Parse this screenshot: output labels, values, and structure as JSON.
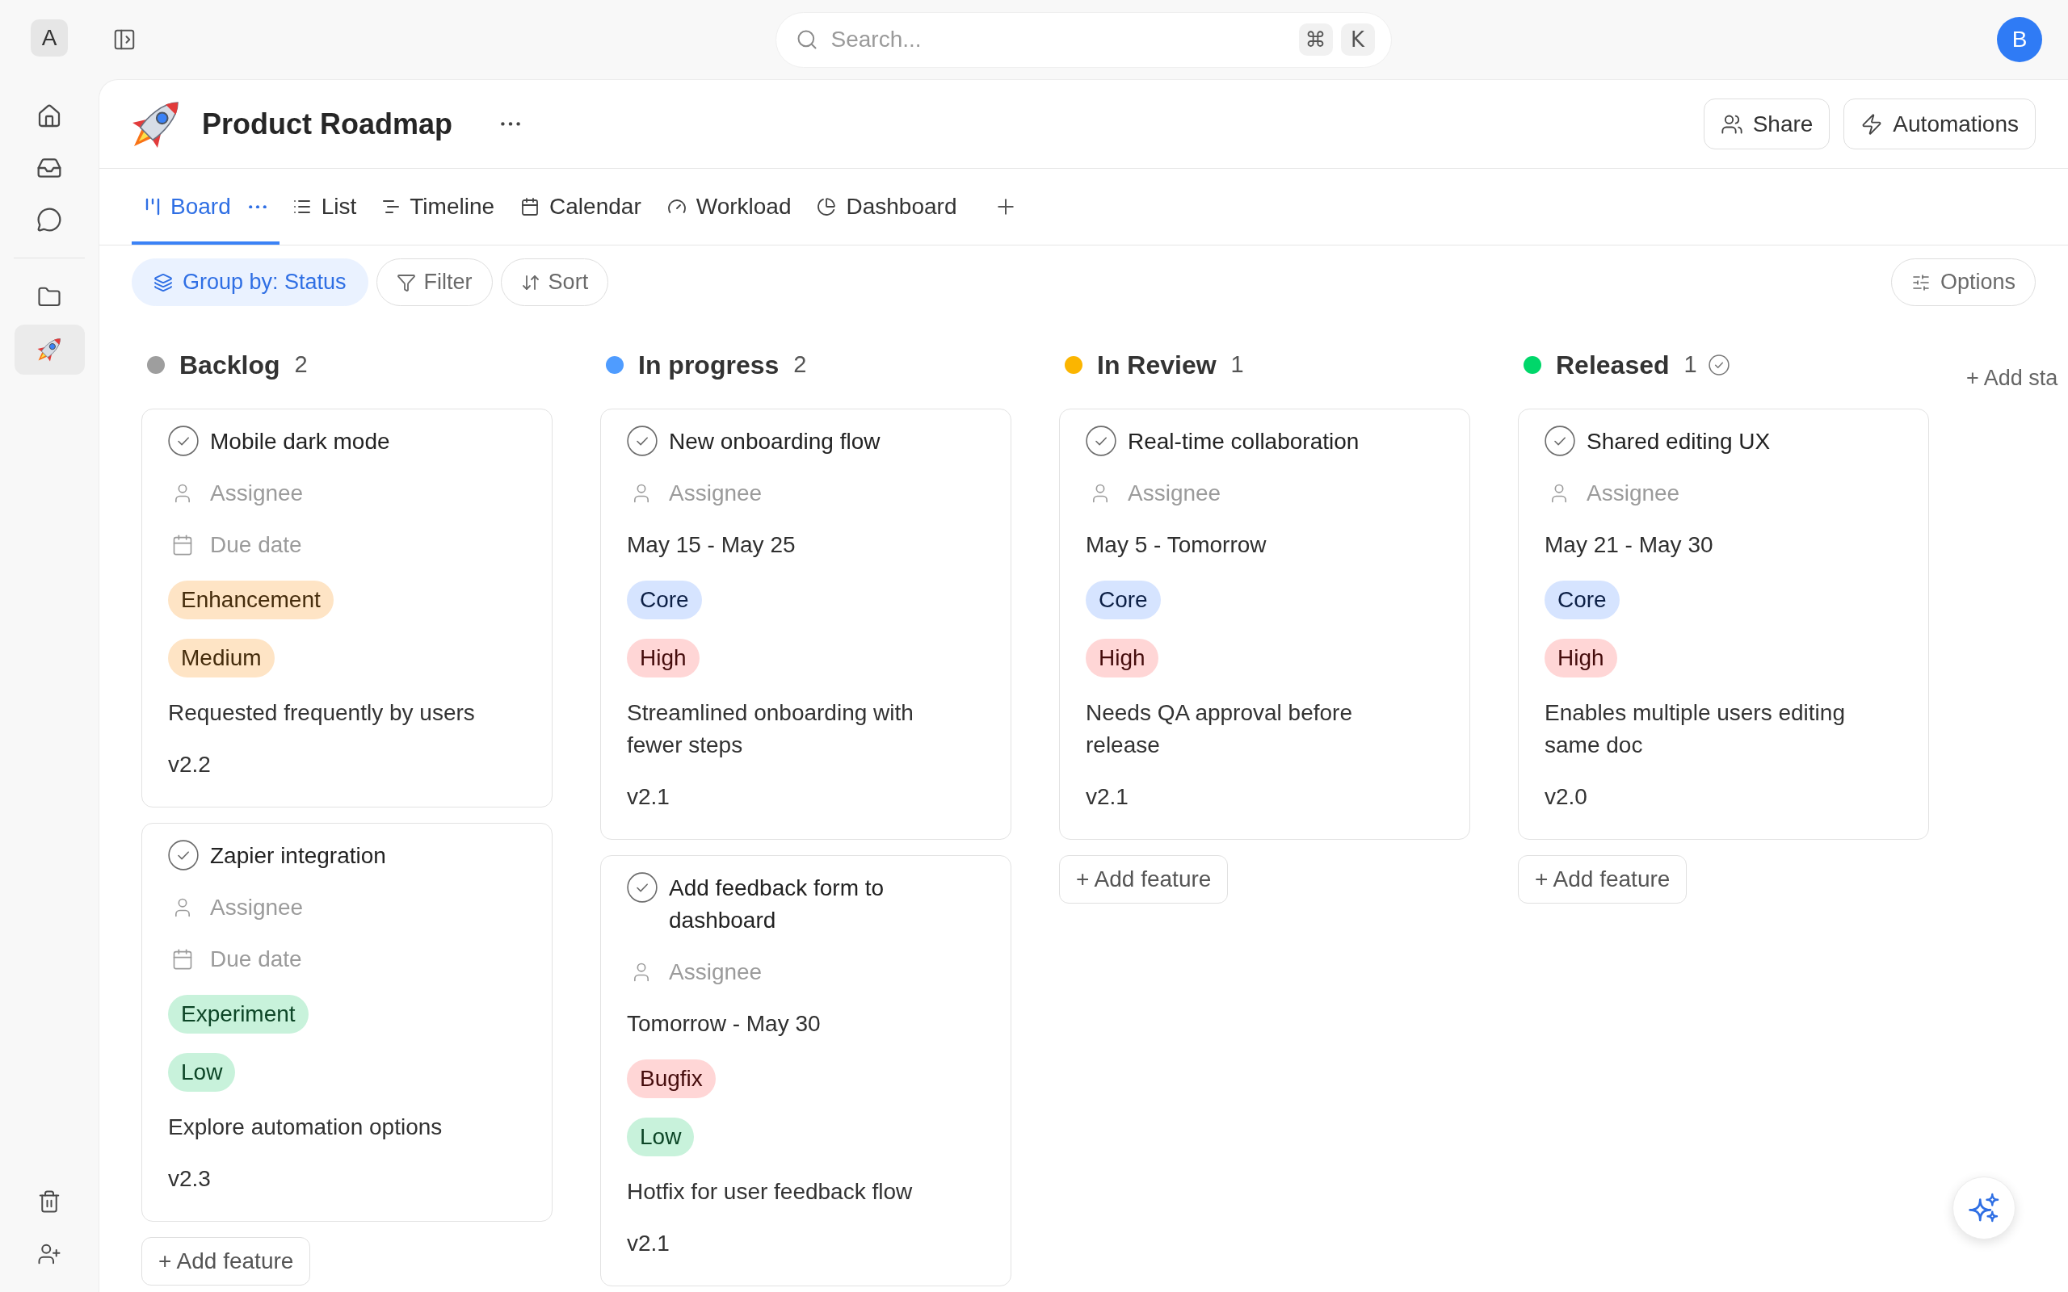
{
  "sidebar": {
    "workspace_avatar": "A",
    "nav": [
      {
        "kind": "home",
        "selected": false
      },
      {
        "kind": "inbox",
        "selected": false
      },
      {
        "kind": "chat",
        "selected": false
      }
    ],
    "projects": [
      {
        "kind": "folder",
        "selected": false
      },
      {
        "kind": "rocket",
        "selected": true
      }
    ]
  },
  "topbar": {
    "search": {
      "placeholder": "Search...",
      "shortcut": [
        "⌘",
        "K"
      ]
    },
    "user_avatar": "B"
  },
  "header": {
    "title": "Product Roadmap",
    "buttons": [
      {
        "kind": "share",
        "label": "Share"
      },
      {
        "kind": "automations",
        "label": "Automations"
      }
    ]
  },
  "tabs": [
    {
      "kind": "board",
      "label": "Board",
      "selected": true
    },
    {
      "kind": "list",
      "label": "List",
      "selected": false
    },
    {
      "kind": "timeline",
      "label": "Timeline",
      "selected": false
    },
    {
      "kind": "calendar",
      "label": "Calendar",
      "selected": false
    },
    {
      "kind": "workload",
      "label": "Workload",
      "selected": false
    },
    {
      "kind": "dashboard",
      "label": "Dashboard",
      "selected": false
    }
  ],
  "toolbar": {
    "buttons": [
      {
        "kind": "group",
        "label": "Group by: Status",
        "active": true
      },
      {
        "kind": "filter",
        "label": "Filter",
        "active": false
      },
      {
        "kind": "sort",
        "label": "Sort",
        "active": false
      }
    ],
    "options": "Options"
  },
  "board": {
    "columns": [
      {
        "name": "Backlog",
        "count": "2",
        "color": "#9e9e9e",
        "complete": false,
        "cards": [
          {
            "title": "Mobile dark mode",
            "assignee": {
              "placeholder": "Assignee"
            },
            "dates": {
              "placeholder": "Due date"
            },
            "tags": [
              {
                "label": "Enhancement",
                "color": "#fee4c5"
              },
              {
                "label": "Medium",
                "color": "#fee4c5"
              }
            ],
            "note": "Requested frequently by users",
            "version": "v2.2"
          },
          {
            "title": "Zapier integration",
            "assignee": {
              "placeholder": "Assignee"
            },
            "dates": {
              "placeholder": "Due date"
            },
            "tags": [
              {
                "label": "Experiment",
                "color": "#c8f2db"
              },
              {
                "label": "Low",
                "color": "#c8f2db"
              }
            ],
            "note": "Explore automation options",
            "version": "v2.3"
          }
        ],
        "add_label": "+ Add feature"
      },
      {
        "name": "In progress",
        "count": "2",
        "color": "#4f9cff",
        "complete": false,
        "cards": [
          {
            "title": "New onboarding flow",
            "assignee": {
              "placeholder": "Assignee"
            },
            "dates": {
              "value": "May 15 - May 25"
            },
            "tags": [
              {
                "label": "Core",
                "color": "#d6e4ff"
              },
              {
                "label": "High",
                "color": "#ffd6d6"
              }
            ],
            "note": "Streamlined onboarding with fewer steps",
            "version": "v2.1"
          },
          {
            "title": "Add feedback form to dashboard",
            "assignee": {
              "placeholder": "Assignee"
            },
            "dates": {
              "value": "Tomorrow - May 30"
            },
            "tags": [
              {
                "label": "Bugfix",
                "color": "#ffd6d6"
              },
              {
                "label": "Low",
                "color": "#c8f2db"
              }
            ],
            "note": "Hotfix for user feedback flow",
            "version": "v2.1"
          }
        ]
      },
      {
        "name": "In Review",
        "count": "1",
        "color": "#fbb500",
        "complete": false,
        "cards": [
          {
            "title": "Real-time collaboration",
            "assignee": {
              "placeholder": "Assignee"
            },
            "dates": {
              "value": "May 5 - Tomorrow"
            },
            "tags": [
              {
                "label": "Core",
                "color": "#d6e4ff"
              },
              {
                "label": "High",
                "color": "#ffd6d6"
              }
            ],
            "note": "Needs QA approval before release",
            "version": "v2.1"
          }
        ],
        "add_label": "+ Add feature"
      },
      {
        "name": "Released",
        "count": "1",
        "color": "#00d76a",
        "complete": true,
        "cards": [
          {
            "title": "Shared editing UX",
            "assignee": {
              "placeholder": "Assignee"
            },
            "dates": {
              "value": "May 21 - May 30"
            },
            "tags": [
              {
                "label": "Core",
                "color": "#d6e4ff"
              },
              {
                "label": "High",
                "color": "#ffd6d6"
              }
            ],
            "note": "Enables multiple users editing same doc",
            "version": "v2.0"
          }
        ],
        "add_label": "+ Add feature"
      }
    ],
    "add_stage": "+ Add sta"
  }
}
